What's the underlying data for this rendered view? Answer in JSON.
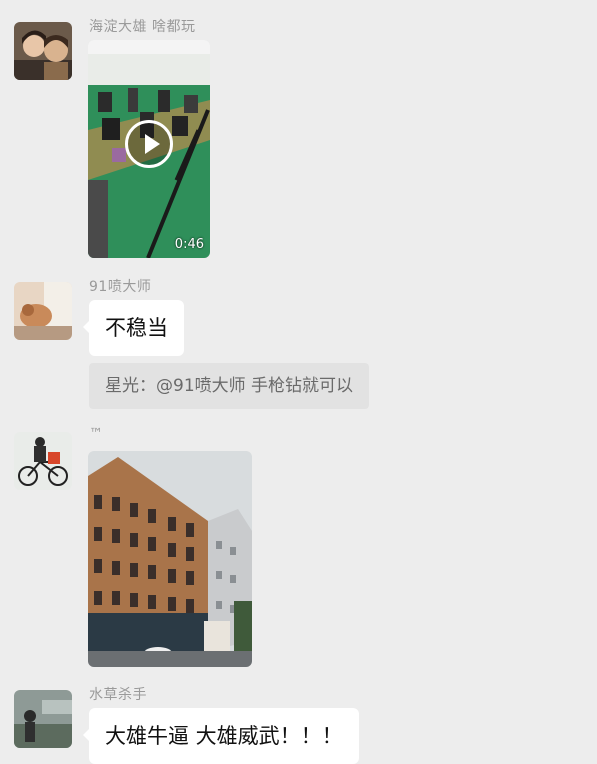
{
  "messages": [
    {
      "sender": "海淀大雄 啥都玩",
      "type": "video",
      "video_duration": "0:46"
    },
    {
      "sender": "91喷大师",
      "type": "text",
      "text": "不稳当",
      "quote": "星光：@91喷大师 手枪钻就可以"
    },
    {
      "sender": "™",
      "type": "image"
    },
    {
      "sender": "水草杀手",
      "type": "text",
      "text": "大雄牛逼 大雄威武！！！"
    }
  ]
}
